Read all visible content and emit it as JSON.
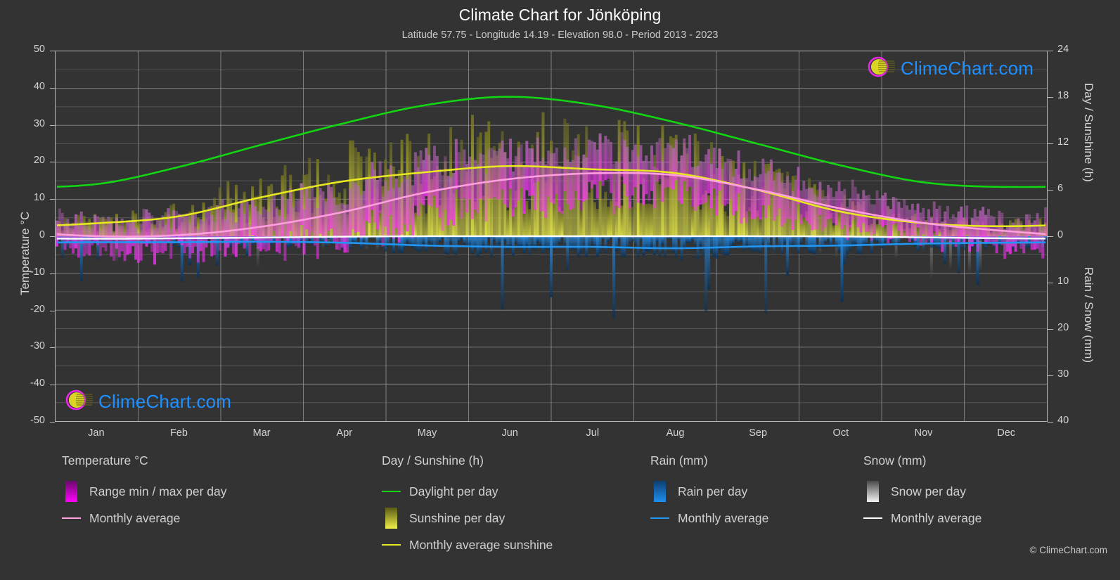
{
  "header": {
    "title": "Climate Chart for Jönköping",
    "subtitle": "Latitude 57.75 - Longitude 14.19 - Elevation 98.0 - Period 2013 - 2023"
  },
  "branding": {
    "logo_text": "ClimeChart.com",
    "copyright": "© ClimeChart.com",
    "logo_text_color": "#1e90ff",
    "logo_arc_color": "#e629e6",
    "logo_sphere_color": "#d9d426"
  },
  "axes": {
    "left_label": "Temperature °C",
    "left_ticks": [
      "50",
      "40",
      "30",
      "20",
      "10",
      "0",
      "-10",
      "-20",
      "-30",
      "-40",
      "-50"
    ],
    "right_top_label": "Day / Sunshine (h)",
    "right_top_ticks": [
      "24",
      "18",
      "12",
      "6",
      "0"
    ],
    "right_bottom_label": "Rain / Snow (mm)",
    "right_bottom_ticks": [
      "10",
      "20",
      "30",
      "40"
    ],
    "x_ticks": [
      "Jan",
      "Feb",
      "Mar",
      "Apr",
      "May",
      "Jun",
      "Jul",
      "Aug",
      "Sep",
      "Oct",
      "Nov",
      "Dec"
    ]
  },
  "legend": {
    "groups": [
      {
        "title": "Temperature °C",
        "items": [
          {
            "label": "Range min / max per day",
            "marker": "gradient-box",
            "color": "#ff00ff",
            "color2": "#6a0a6a"
          },
          {
            "label": "Monthly average",
            "marker": "line",
            "color": "#ff9fe0"
          }
        ]
      },
      {
        "title": "Day / Sunshine (h)",
        "items": [
          {
            "label": "Daylight per day",
            "marker": "line",
            "color": "#13d613"
          },
          {
            "label": "Sunshine per day",
            "marker": "gradient-box",
            "color": "#efef4a",
            "color2": "#5a5a16"
          },
          {
            "label": "Monthly average sunshine",
            "marker": "line",
            "color": "#e8e822"
          }
        ]
      },
      {
        "title": "Rain (mm)",
        "items": [
          {
            "label": "Rain per day",
            "marker": "gradient-box",
            "color": "#1f8fef",
            "color2": "#0c3f70"
          },
          {
            "label": "Monthly average",
            "marker": "line",
            "color": "#2196f3"
          }
        ]
      },
      {
        "title": "Snow (mm)",
        "items": [
          {
            "label": "Snow per day",
            "marker": "gradient-box",
            "color": "#f2f2f2",
            "color2": "#4a4a4a"
          },
          {
            "label": "Monthly average",
            "marker": "line",
            "color": "#ffffff"
          }
        ]
      }
    ]
  },
  "chart_data": {
    "type": "line",
    "title": "Climate Chart for Jönköping",
    "subtitle": "Latitude 57.75 - Longitude 14.19 - Elevation 98.0 - Period 2013 - 2023",
    "location": {
      "latitude": 57.75,
      "longitude": 14.19,
      "elevation": 98.0,
      "period": "2013 - 2023"
    },
    "xlabel": "",
    "x_categories": [
      "Jan",
      "Feb",
      "Mar",
      "Apr",
      "May",
      "Jun",
      "Jul",
      "Aug",
      "Sep",
      "Oct",
      "Nov",
      "Dec"
    ],
    "axes": {
      "left": {
        "label": "Temperature °C",
        "min": -50,
        "max": 50,
        "step": 10
      },
      "right_top": {
        "label": "Day / Sunshine (h)",
        "min": 0,
        "max": 24,
        "step": 6
      },
      "right_bottom": {
        "label": "Rain / Snow (mm)",
        "min": 0,
        "max": 40,
        "step": 10
      }
    },
    "grid": true,
    "legend_position": "below",
    "series": [
      {
        "name": "Daylight per day",
        "unit": "h",
        "axis": "right_top",
        "color": "#13d613",
        "values": [
          6.8,
          9.0,
          11.8,
          14.6,
          17.0,
          18.1,
          17.1,
          14.8,
          12.0,
          9.2,
          7.0,
          6.4
        ]
      },
      {
        "name": "Monthly average sunshine",
        "unit": "h",
        "axis": "right_top",
        "color": "#e8e822",
        "values": [
          1.7,
          2.6,
          5.0,
          7.1,
          8.3,
          9.1,
          8.7,
          8.2,
          6.0,
          3.2,
          1.7,
          1.3
        ]
      },
      {
        "name": "Monthly average temperature",
        "unit": "°C",
        "axis": "left",
        "color": "#ff9fe0",
        "values": [
          0.0,
          0.3,
          2.5,
          6.5,
          11.8,
          15.4,
          17.0,
          16.5,
          12.6,
          7.5,
          3.6,
          1.4
        ]
      },
      {
        "name": "Monthly average rain",
        "unit": "mm",
        "axis": "right_bottom",
        "color": "#2196f3",
        "values": [
          1.3,
          1.3,
          1.2,
          1.4,
          2.0,
          2.3,
          2.3,
          2.6,
          2.2,
          2.0,
          1.6,
          1.4
        ]
      },
      {
        "name": "Monthly average snow",
        "unit": "mm",
        "axis": "right_bottom",
        "color": "#ffffff",
        "values": [
          0.55,
          0.45,
          0.3,
          0.1,
          0.0,
          0.0,
          0.0,
          0.0,
          0.0,
          0.05,
          0.25,
          0.45
        ]
      }
    ],
    "daily_bands": [
      {
        "name": "Range min / max per day",
        "axis": "left",
        "color_hi": "#ff00ff",
        "color_lo": "#6a0a6a"
      },
      {
        "name": "Sunshine per day",
        "axis": "right_top",
        "color_hi": "#efef4a",
        "color_lo": "#5a5a16"
      },
      {
        "name": "Rain per day",
        "axis": "right_bottom",
        "color_hi": "#1f8fef",
        "color_lo": "#0c3f70"
      },
      {
        "name": "Snow per day",
        "axis": "right_bottom",
        "color_hi": "#f2f2f2",
        "color_lo": "#4a4a4a"
      }
    ],
    "monthly_temp_min": [
      -3.0,
      -3.2,
      -1.4,
      1.6,
      6.4,
      10.2,
      12.2,
      11.8,
      8.4,
      4.2,
      0.8,
      -1.6
    ],
    "monthly_temp_max": [
      3.0,
      3.6,
      7.0,
      12.0,
      17.6,
      21.0,
      22.4,
      21.6,
      17.0,
      11.0,
      6.2,
      4.0
    ]
  }
}
